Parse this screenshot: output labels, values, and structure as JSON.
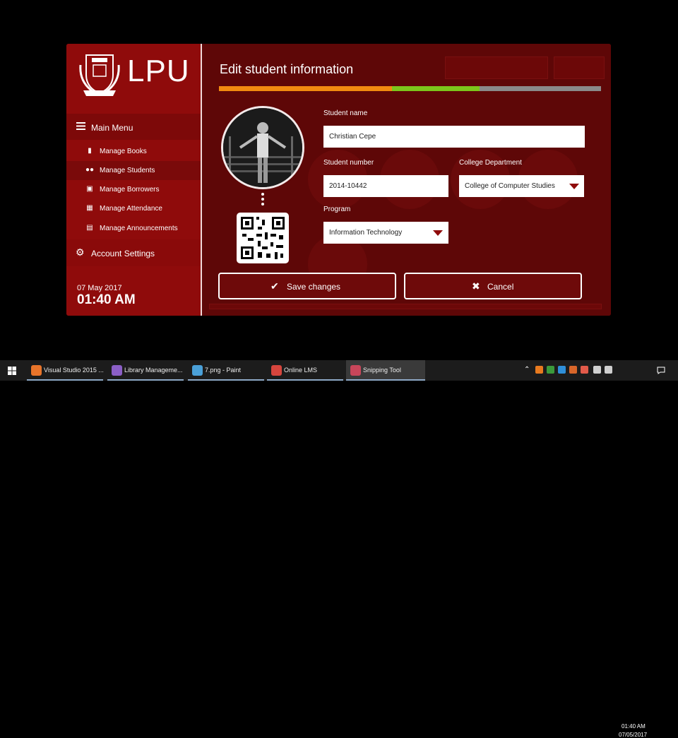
{
  "brand": {
    "logo_text": "LPU"
  },
  "sidebar": {
    "main_menu_label": "Main Menu",
    "items": [
      {
        "label": "Manage Books",
        "icon": "book-icon"
      },
      {
        "label": "Manage Students",
        "icon": "users-icon"
      },
      {
        "label": "Manage Borrowers",
        "icon": "borrower-icon"
      },
      {
        "label": "Manage Attendance",
        "icon": "attendance-icon"
      },
      {
        "label": "Manage Announcements",
        "icon": "announcement-icon"
      }
    ],
    "account_label": "Account Settings",
    "date": "07 May 2017",
    "time": "01:40 AM"
  },
  "modal": {
    "title": "Edit student information",
    "progress_colors": [
      "#f28b10",
      "#7cc61c",
      "#8a8a8a"
    ],
    "student_name_label": "Student name",
    "student_name_value": "Christian Cepe",
    "student_number_label": "Student number",
    "student_number_value": "2014-10442",
    "college_label": "College Department",
    "college_value": "College of Computer Studies",
    "program_label": "Program",
    "program_value": "Information Technology",
    "save_label": "Save changes",
    "cancel_label": "Cancel"
  },
  "taskbar": {
    "items": [
      {
        "label": "Visual Studio 2015 ...",
        "color": "#e8742a"
      },
      {
        "label": "Library Manageme...",
        "color": "#8b5fc6"
      },
      {
        "label": "7.png - Paint",
        "color": "#4aa0d8"
      },
      {
        "label": "Online LMS",
        "color": "#d6453d"
      },
      {
        "label": "Snipping Tool",
        "color": "#c8465a"
      }
    ],
    "clock_time": "01:40 AM",
    "clock_date": "07/05/2017"
  }
}
